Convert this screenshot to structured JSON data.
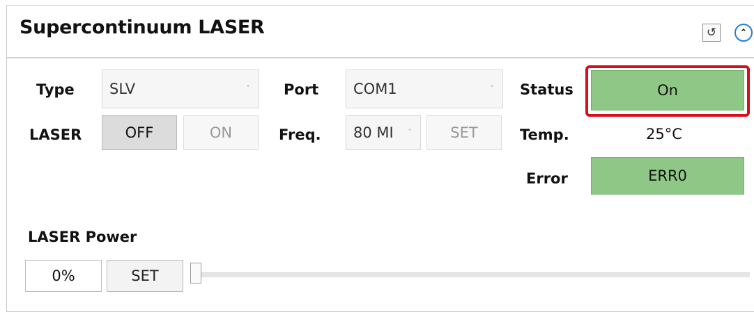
{
  "panel": {
    "title": "Supercontinuum LASER",
    "refresh_icon": "↺",
    "collapse_icon": "⌃"
  },
  "controls": {
    "type_label": "Type",
    "type_value": "SLV",
    "port_label": "Port",
    "port_value": "COM1",
    "laser_label": "LASER",
    "laser_off": "OFF",
    "laser_on": "ON",
    "freq_label": "Freq.",
    "freq_value": "80 MI",
    "freq_set": "SET",
    "chevron": "˅"
  },
  "status": {
    "status_label": "Status",
    "status_value": "On",
    "temp_label": "Temp.",
    "temp_value": "25°C",
    "error_label": "Error",
    "error_value": "ERR0",
    "status_color": "#8fc786",
    "highlight_color": "#d90d1b"
  },
  "power": {
    "label": "LASER Power",
    "value": "0%",
    "set": "SET",
    "slider_level": 0
  }
}
